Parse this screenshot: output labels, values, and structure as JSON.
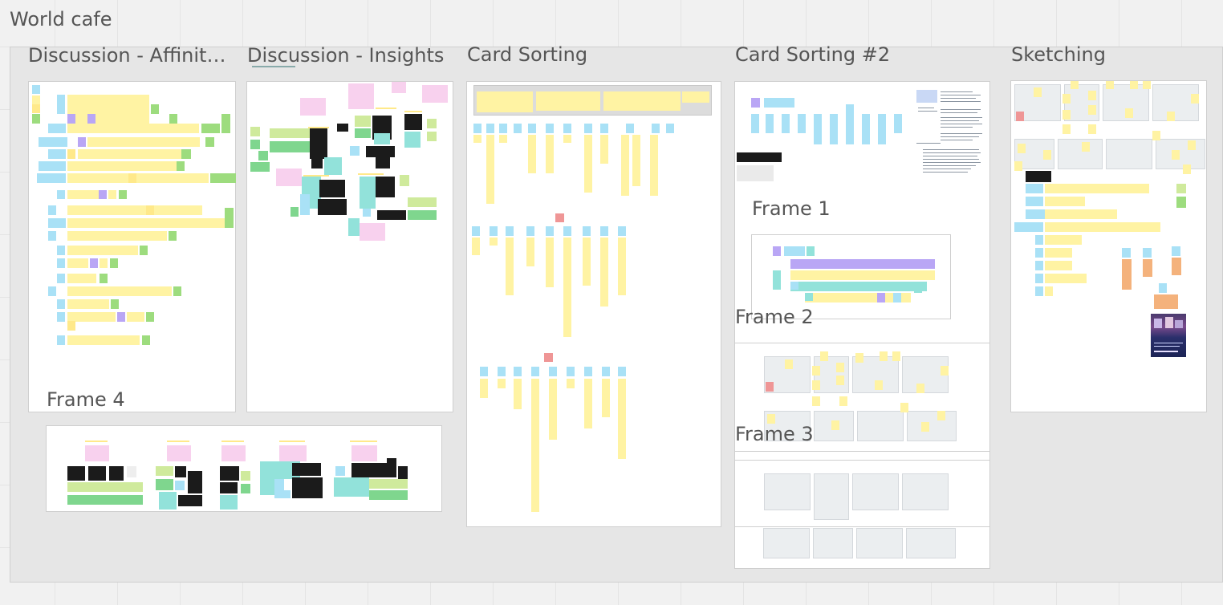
{
  "board": {
    "title": "World cafe"
  },
  "frames": {
    "affinity": "Discussion - Affinity Mapping",
    "insights": "Discussion - Insights",
    "card_sorting": "Card Sorting",
    "card_sorting_2": "Card Sorting #2",
    "sketching": "Sketching",
    "frame1": "Frame 1",
    "frame2": "Frame 2",
    "frame3": "Frame 3",
    "frame4": "Frame 4"
  },
  "colors": {
    "yellow": "#fff3a3",
    "blue": "#a9e1f6",
    "purple": "#b9a6f5",
    "green": "#9ddc7e",
    "pink": "#f8d1ee",
    "teal": "#92e2da",
    "black": "#1b1b1b",
    "red": "#ef9696",
    "orange": "#f4b27c"
  }
}
